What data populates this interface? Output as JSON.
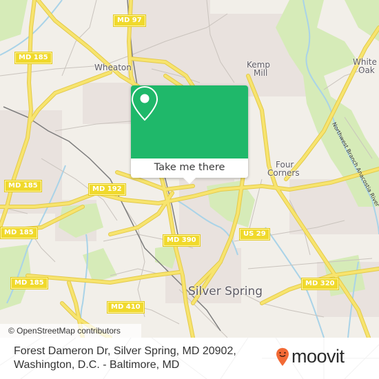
{
  "map": {
    "attribution": "© OpenStreetMap contributors",
    "colors": {
      "land": "#f2efe9",
      "residential": "#e8e0dc",
      "park": "#cde8a8",
      "water": "#a9d3e8",
      "major_road": "#f6e26a",
      "road_casing": "#e8cf52",
      "minor_road": "#b8b3ad",
      "rail": "#7a7a7a"
    },
    "places": [
      {
        "name": "Wheaton",
        "size": "med"
      },
      {
        "name": "Kemp",
        "size": "med"
      },
      {
        "name": "Mill",
        "size": "med"
      },
      {
        "name": "White",
        "size": "med"
      },
      {
        "name": "Oak",
        "size": "med"
      },
      {
        "name": "Four",
        "size": "med"
      },
      {
        "name": "Corners",
        "size": "med"
      },
      {
        "name": "Silver Spring",
        "size": "big"
      }
    ],
    "river_label": "Northwest Branch Anacostia River",
    "road_shields": [
      {
        "label": "MD 97"
      },
      {
        "label": "MD 185"
      },
      {
        "label": "MD 185"
      },
      {
        "label": "MD 185"
      },
      {
        "label": "MD 185"
      },
      {
        "label": "MD 192"
      },
      {
        "label": "MD 390"
      },
      {
        "label": "US 29"
      },
      {
        "label": "MD 320"
      },
      {
        "label": "MD 410"
      }
    ]
  },
  "popup": {
    "button_label": "Take me there",
    "icon": "map-pin-icon",
    "color": "#1fb86a"
  },
  "footer": {
    "address_line1": "Forest Dameron Dr, Silver Spring, MD 20902,",
    "address_line2": "Washington, D.C. - Baltimore, MD",
    "brand": "moovit",
    "brand_icon_color": "#f26a35"
  }
}
